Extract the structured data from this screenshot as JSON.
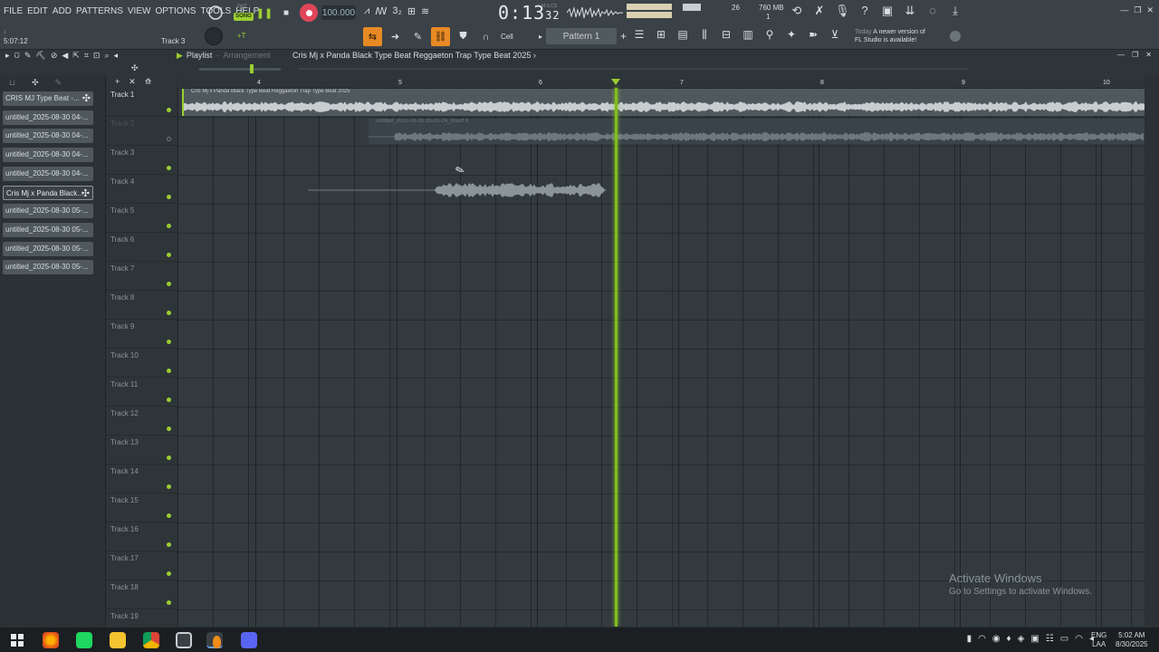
{
  "menu": [
    "FILE",
    "EDIT",
    "ADD",
    "PATTERNS",
    "VIEW",
    "OPTIONS",
    "TOOLS",
    "HELP"
  ],
  "transport": {
    "pat_label": "PAT",
    "song_label": "SONG",
    "tempo": "100.000",
    "time_main": "0:13",
    "time_small": "32",
    "time_unit": "M:S:CS"
  },
  "meters": {
    "voices": "26",
    "memory": "760 MB",
    "poly": "1"
  },
  "hint_bar": {
    "hint": "1",
    "position": "5:07:12",
    "target": "Track 3"
  },
  "tools": {
    "snap": "Cell"
  },
  "pattern": {
    "name": "Pattern 1"
  },
  "news": {
    "today": "Today",
    "line1": "A newer version of",
    "line2": "FL Studio is available!"
  },
  "playlist": {
    "title": "Playlist",
    "mode": "Arrangement",
    "song_title": "Cris Mj x Panda Black Type Beat  Reggaeton Trap Type Beat 2025"
  },
  "picker": {
    "items": [
      {
        "label": "CRIS MJ Type Beat -...",
        "selected": false
      },
      {
        "label": "untitled_2025-08-30 04-...",
        "selected": false
      },
      {
        "label": "untitled_2025-08-30 04-...",
        "selected": false
      },
      {
        "label": "untitled_2025-08-30 04-...",
        "selected": false
      },
      {
        "label": "untitled_2025-08-30 04-...",
        "selected": false
      },
      {
        "label": "Cris Mj x Panda Black...",
        "selected": true
      },
      {
        "label": "untitled_2025-08-30 05-...",
        "selected": false
      },
      {
        "label": "untitled_2025-08-30 05-...",
        "selected": false
      },
      {
        "label": "untitled_2025-08-30 05-...",
        "selected": false
      },
      {
        "label": "untitled_2025-08-30 05-...",
        "selected": false
      }
    ]
  },
  "tracks": [
    "Track 1",
    "Track 2",
    "Track 3",
    "Track 4",
    "Track 5",
    "Track 6",
    "Track 7",
    "Track 8",
    "Track 9",
    "Track 10",
    "Track 11",
    "Track 12",
    "Track 13",
    "Track 14",
    "Track 15",
    "Track 16",
    "Track 17",
    "Track 18",
    "Track 19"
  ],
  "ruler": {
    "bars": [
      "4",
      "5",
      "6",
      "7",
      "8",
      "9",
      "10"
    ]
  },
  "clips": {
    "clip1": "Cris Mj x Panda Black Type Beat  Reggaeton Trap Type Beat 2025",
    "clip2": "untitled_2025-08-30 05-03-24_Insert 6"
  },
  "watermark": {
    "line1": "Activate Windows",
    "line2": "Go to Settings to activate Windows."
  },
  "taskbar": {
    "lang1": "ENG",
    "lang2": "LAA",
    "time": "5:02 AM",
    "date": "8/30/2025"
  },
  "colors": {
    "accent": "#9acd32",
    "record": "#e0455a",
    "tool_active": "#e88a24",
    "background": "#323a3f"
  }
}
